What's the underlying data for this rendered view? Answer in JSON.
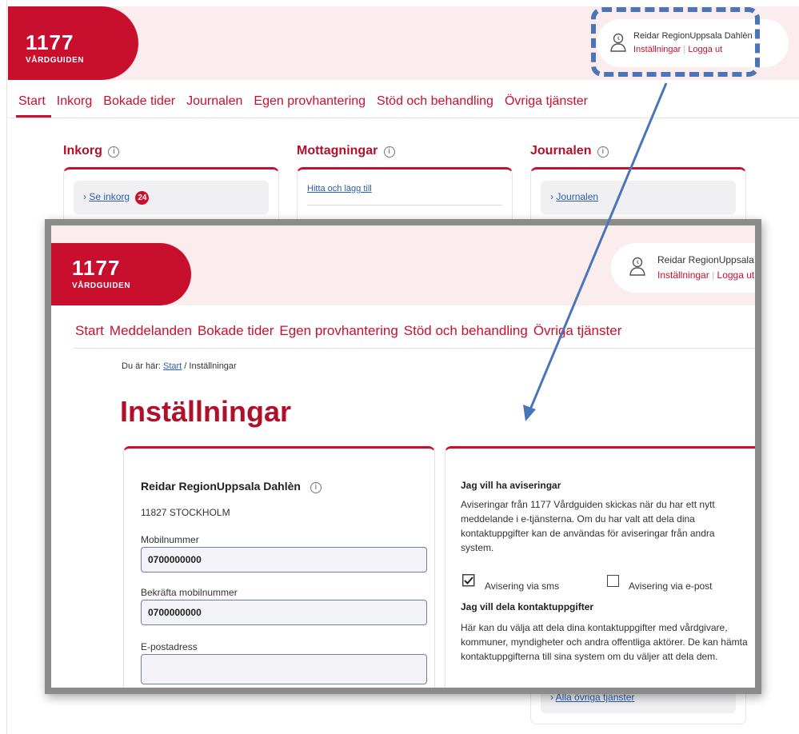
{
  "background": {
    "logo": {
      "number": "1177",
      "subtitle": "VÅRDGUIDEN"
    },
    "user": {
      "name": "Reidar RegionUppsala Dahlèn",
      "settings_link": "Inställningar",
      "logout_link": "Logga ut",
      "separator": "|"
    },
    "nav": [
      "Start",
      "Inkorg",
      "Bokade tider",
      "Journalen",
      "Egen provhantering",
      "Stöd och behandling",
      "Övriga tjänster"
    ],
    "sections": {
      "inkorg": {
        "title": "Inkorg",
        "link": "Se inkorg",
        "badge": "24"
      },
      "mottagningar": {
        "title": "Mottagningar",
        "link": "Hitta och lägg till"
      },
      "journalen": {
        "title": "Journalen",
        "link": "Journalen"
      },
      "ovriga": {
        "link": "Alla övriga tjänster"
      }
    },
    "info_icon": "i",
    "chevron": "›"
  },
  "settings_window": {
    "logo": {
      "number": "1177",
      "subtitle": "VÅRDGUIDEN"
    },
    "user": {
      "name": "Reidar RegionUppsala Dahlèn",
      "settings_link": "Inställningar",
      "logout_link": "Logga ut",
      "separator": "|"
    },
    "nav": [
      "Start",
      "Meddelanden",
      "Bokade tider",
      "Egen provhantering",
      "Stöd och behandling",
      "Övriga tjänster"
    ],
    "breadcrumb": {
      "prefix": "Du är här:",
      "start": "Start",
      "current": "/ Inställningar"
    },
    "title": "Inställningar",
    "contact": {
      "name": "Reidar RegionUppsala Dahlèn",
      "address": "11827 STOCKHOLM",
      "mobile_label": "Mobilnummer",
      "mobile_value": "0700000000",
      "confirm_label": "Bekräfta mobilnummer",
      "confirm_value": "0700000000",
      "email_label": "E-postadress",
      "email_value": ""
    },
    "notifications": {
      "heading": "Jag vill ha aviseringar",
      "text": "Aviseringar från 1177 Vårdguiden skickas när du har ett nytt meddelande i e-tjänsterna. Om du har valt att dela dina kontaktuppgifter kan de användas för aviseringar från andra system.",
      "sms_label": "Avisering via sms",
      "sms_checked": true,
      "email_label": "Avisering via e-post",
      "email_checked": false,
      "share_heading": "Jag vill dela kontaktuppgifter",
      "share_text": "Här kan du välja att dela dina kontaktuppgifter med vårdgivare, kommuner, myndigheter och andra offentliga aktörer. De kan hämta kontaktuppgifterna till sina system om du väljer att dela dem."
    }
  },
  "colors": {
    "brand": "#c8102e",
    "header_bg": "#fbecee",
    "link": "#2a5db0",
    "highlight": "#4a76b8"
  }
}
